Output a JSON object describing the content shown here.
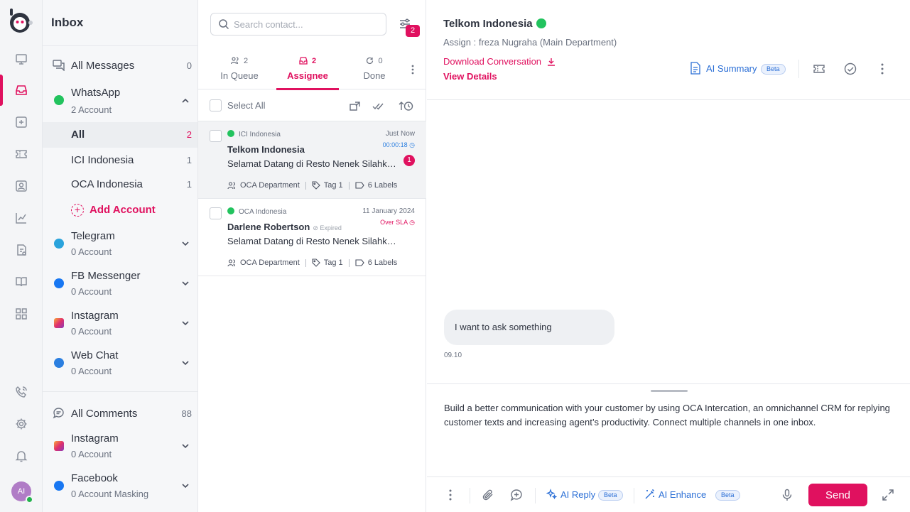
{
  "rail": {
    "avatar_initials": "AI"
  },
  "sidebar": {
    "title": "Inbox",
    "all_messages": {
      "label": "All Messages",
      "count": "0"
    },
    "whatsapp": {
      "label": "WhatsApp",
      "sub": "2 Account",
      "items": [
        {
          "label": "All",
          "count": "2"
        },
        {
          "label": "ICI Indonesia",
          "count": "1"
        },
        {
          "label": "OCA Indonesia",
          "count": "1"
        }
      ],
      "add_account": "Add Account"
    },
    "channels": [
      {
        "label": "Telegram",
        "sub": "0 Account"
      },
      {
        "label": "FB Messenger",
        "sub": "0 Account"
      },
      {
        "label": "Instagram",
        "sub": "0 Account"
      },
      {
        "label": "Web Chat",
        "sub": "0 Account"
      }
    ],
    "all_comments": {
      "label": "All Comments",
      "count": "88"
    },
    "comment_channels": [
      {
        "label": "Instagram",
        "sub": "0 Account"
      },
      {
        "label": "Facebook",
        "sub": "0 Account Masking"
      }
    ]
  },
  "list": {
    "search_placeholder": "Search contact...",
    "filter_badge": "2",
    "tabs": [
      {
        "count": "2",
        "label": "In Queue"
      },
      {
        "count": "2",
        "label": "Assignee"
      },
      {
        "count": "0",
        "label": "Done"
      }
    ],
    "select_all": "Select All",
    "conversations": [
      {
        "channel": "ICI Indonesia",
        "time": "Just Now",
        "timer": "00:00:18",
        "name": "Telkom Indonesia",
        "expired": "",
        "message": "Selamat Datang di Resto Nenek Silahkan Pesan Makanan",
        "unread": "1",
        "department": "OCA Department",
        "tag": "Tag 1",
        "labels": "6 Labels"
      },
      {
        "channel": "OCA Indonesia",
        "time": "11 January 2024",
        "timer": "Over SLA",
        "name": "Darlene Robertson",
        "expired": "Expired",
        "message": "Selamat Datang di Resto Nenek Silahkan Pesan Makanan",
        "unread": "",
        "department": "OCA Department",
        "tag": "Tag 1",
        "labels": "6 Labels"
      }
    ]
  },
  "chat": {
    "contact_name": "Telkom Indonesia",
    "assign": "Assign : freza Nugraha (Main Department)",
    "download": "Download Conversation",
    "view_details": "View Details",
    "ai_summary": "AI Summary",
    "beta": "Beta",
    "bubble_text": "I want to ask something",
    "bubble_time": "09.10",
    "composer_text": "Build a better communication with your customer by using OCA Intercation, an omnichannel CRM for replying customer texts and increasing agent’s productivity. Connect multiple channels in one inbox.",
    "ai_reply": "AI Reply",
    "ai_enhance": "AI Enhance",
    "send": "Send"
  }
}
